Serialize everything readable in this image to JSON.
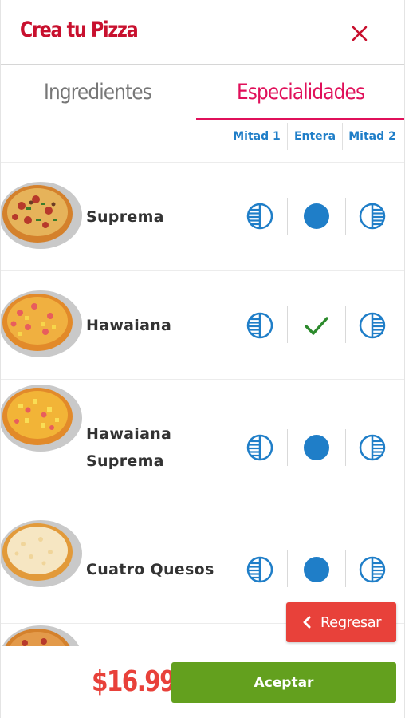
{
  "header": {
    "title": "Crea tu Pizza",
    "close_icon": "close-icon"
  },
  "tabs": [
    {
      "label": "Ingredientes",
      "active": false
    },
    {
      "label": "Especialidades",
      "active": true
    }
  ],
  "columns": {
    "half1": "Mitad 1",
    "whole": "Entera",
    "half2": "Mitad 2"
  },
  "pizzas": [
    {
      "name_lines": [
        "Suprema"
      ],
      "selection": "none",
      "image": "suprema-pizza"
    },
    {
      "name_lines": [
        "Hawaiana"
      ],
      "selection": "whole",
      "image": "hawaiana-pizza"
    },
    {
      "name_lines": [
        "Hawaiana",
        "Suprema"
      ],
      "selection": "none",
      "image": "hawaiana-suprema-pizza"
    },
    {
      "name_lines": [
        "Cuatro Quesos"
      ],
      "selection": "none",
      "image": "cuatro-quesos-pizza"
    }
  ],
  "back_button": {
    "label": "Regresar",
    "icon": "chevron-left-icon"
  },
  "footer": {
    "price": "$16.99",
    "accept_label": "Aceptar"
  },
  "colors": {
    "title_red": "#c8102e",
    "tab_active_pink": "#e0105a",
    "option_blue": "#1f7ec8",
    "check_green": "#2c8a2c",
    "back_red": "#e8413a",
    "accept_green": "#63a01e"
  }
}
